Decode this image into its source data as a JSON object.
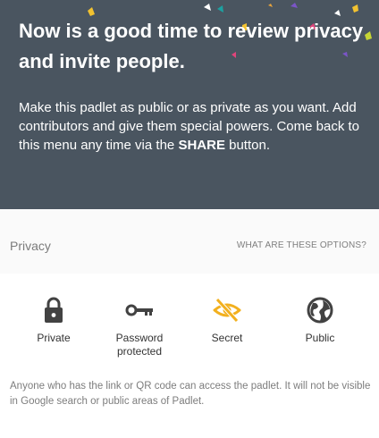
{
  "hero": {
    "title": "Now is a good time to review privacy and invite people.",
    "desc_main": "Make this padlet as public or as private as you want. Add contributors and give them special powers. Come back to this menu any time via the",
    "desc_emphasis": "SHARE",
    "desc_end": "button."
  },
  "privacy": {
    "label": "Privacy",
    "options_link": "WHAT ARE THESE OPTIONS?",
    "options": [
      {
        "label": "Private",
        "icon": "lock-icon",
        "selected": false
      },
      {
        "label": "Password protected",
        "icon": "key-icon",
        "selected": false
      },
      {
        "label": "Secret",
        "icon": "eye-off-icon",
        "selected": true
      },
      {
        "label": "Public",
        "icon": "globe-icon",
        "selected": false
      }
    ],
    "description": "Anyone who has the link or QR code can access the padlet. It will not be visible in Google search or public areas of Padlet."
  },
  "colors": {
    "hero_bg": "#4a5560",
    "accent_selected": "#f2b01e",
    "icon_default": "#424242"
  }
}
